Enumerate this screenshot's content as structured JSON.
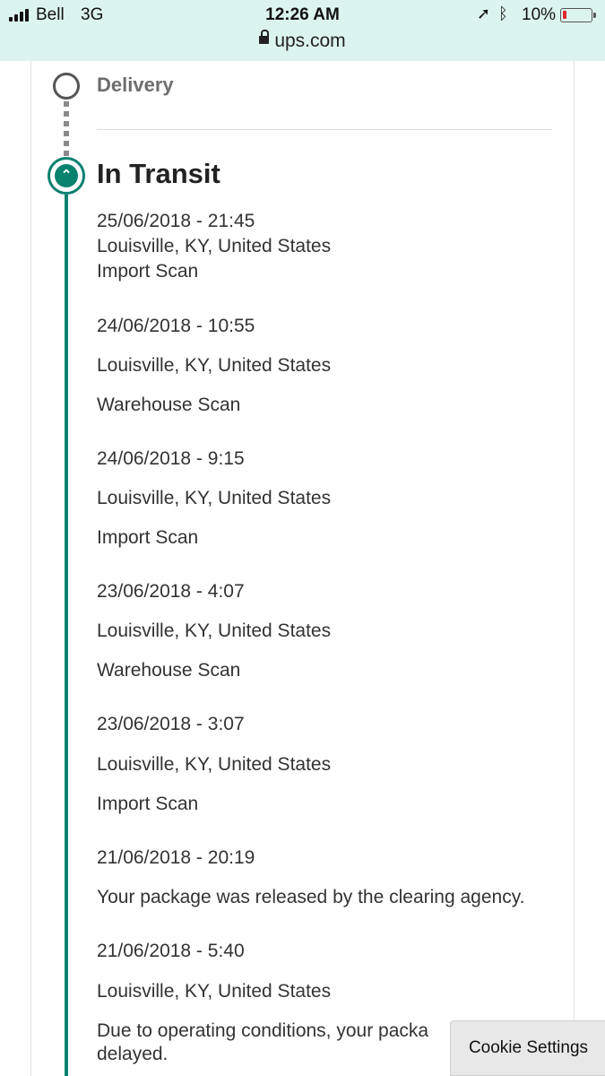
{
  "status_bar": {
    "carrier": "Bell",
    "network": "3G",
    "time": "12:26 AM",
    "battery_percent_label": "10%",
    "battery_level": 0.1,
    "location_icon": "location-arrow-icon",
    "bluetooth_icon": "bluetooth-icon"
  },
  "browser": {
    "url": "ups.com"
  },
  "tracking": {
    "delivery_label": "Delivery",
    "transit_label": "In Transit",
    "transit_icon": "chevron-up-icon",
    "accent_color": "#0a8270",
    "events": [
      {
        "datetime": "25/06/2018 - 21:45",
        "location": "Louisville, KY, United States",
        "description": "Import Scan"
      },
      {
        "datetime": "24/06/2018 - 10:55",
        "location": "Louisville, KY, United States",
        "description": "Warehouse Scan"
      },
      {
        "datetime": "24/06/2018 - 9:15",
        "location": "Louisville, KY, United States",
        "description": "Import Scan"
      },
      {
        "datetime": "23/06/2018 - 4:07",
        "location": "Louisville, KY, United States",
        "description": "Warehouse Scan"
      },
      {
        "datetime": "23/06/2018 - 3:07",
        "location": "Louisville, KY, United States",
        "description": "Import Scan"
      },
      {
        "datetime": "21/06/2018 - 20:19",
        "description": "Your package was released by the clearing agency."
      },
      {
        "datetime": "21/06/2018 - 5:40",
        "location": "Louisville, KY, United States",
        "description_line1": "Due to operating conditions, your packa",
        "description_line2": "delayed."
      }
    ]
  },
  "cookie_button": {
    "label": "Cookie Settings"
  }
}
